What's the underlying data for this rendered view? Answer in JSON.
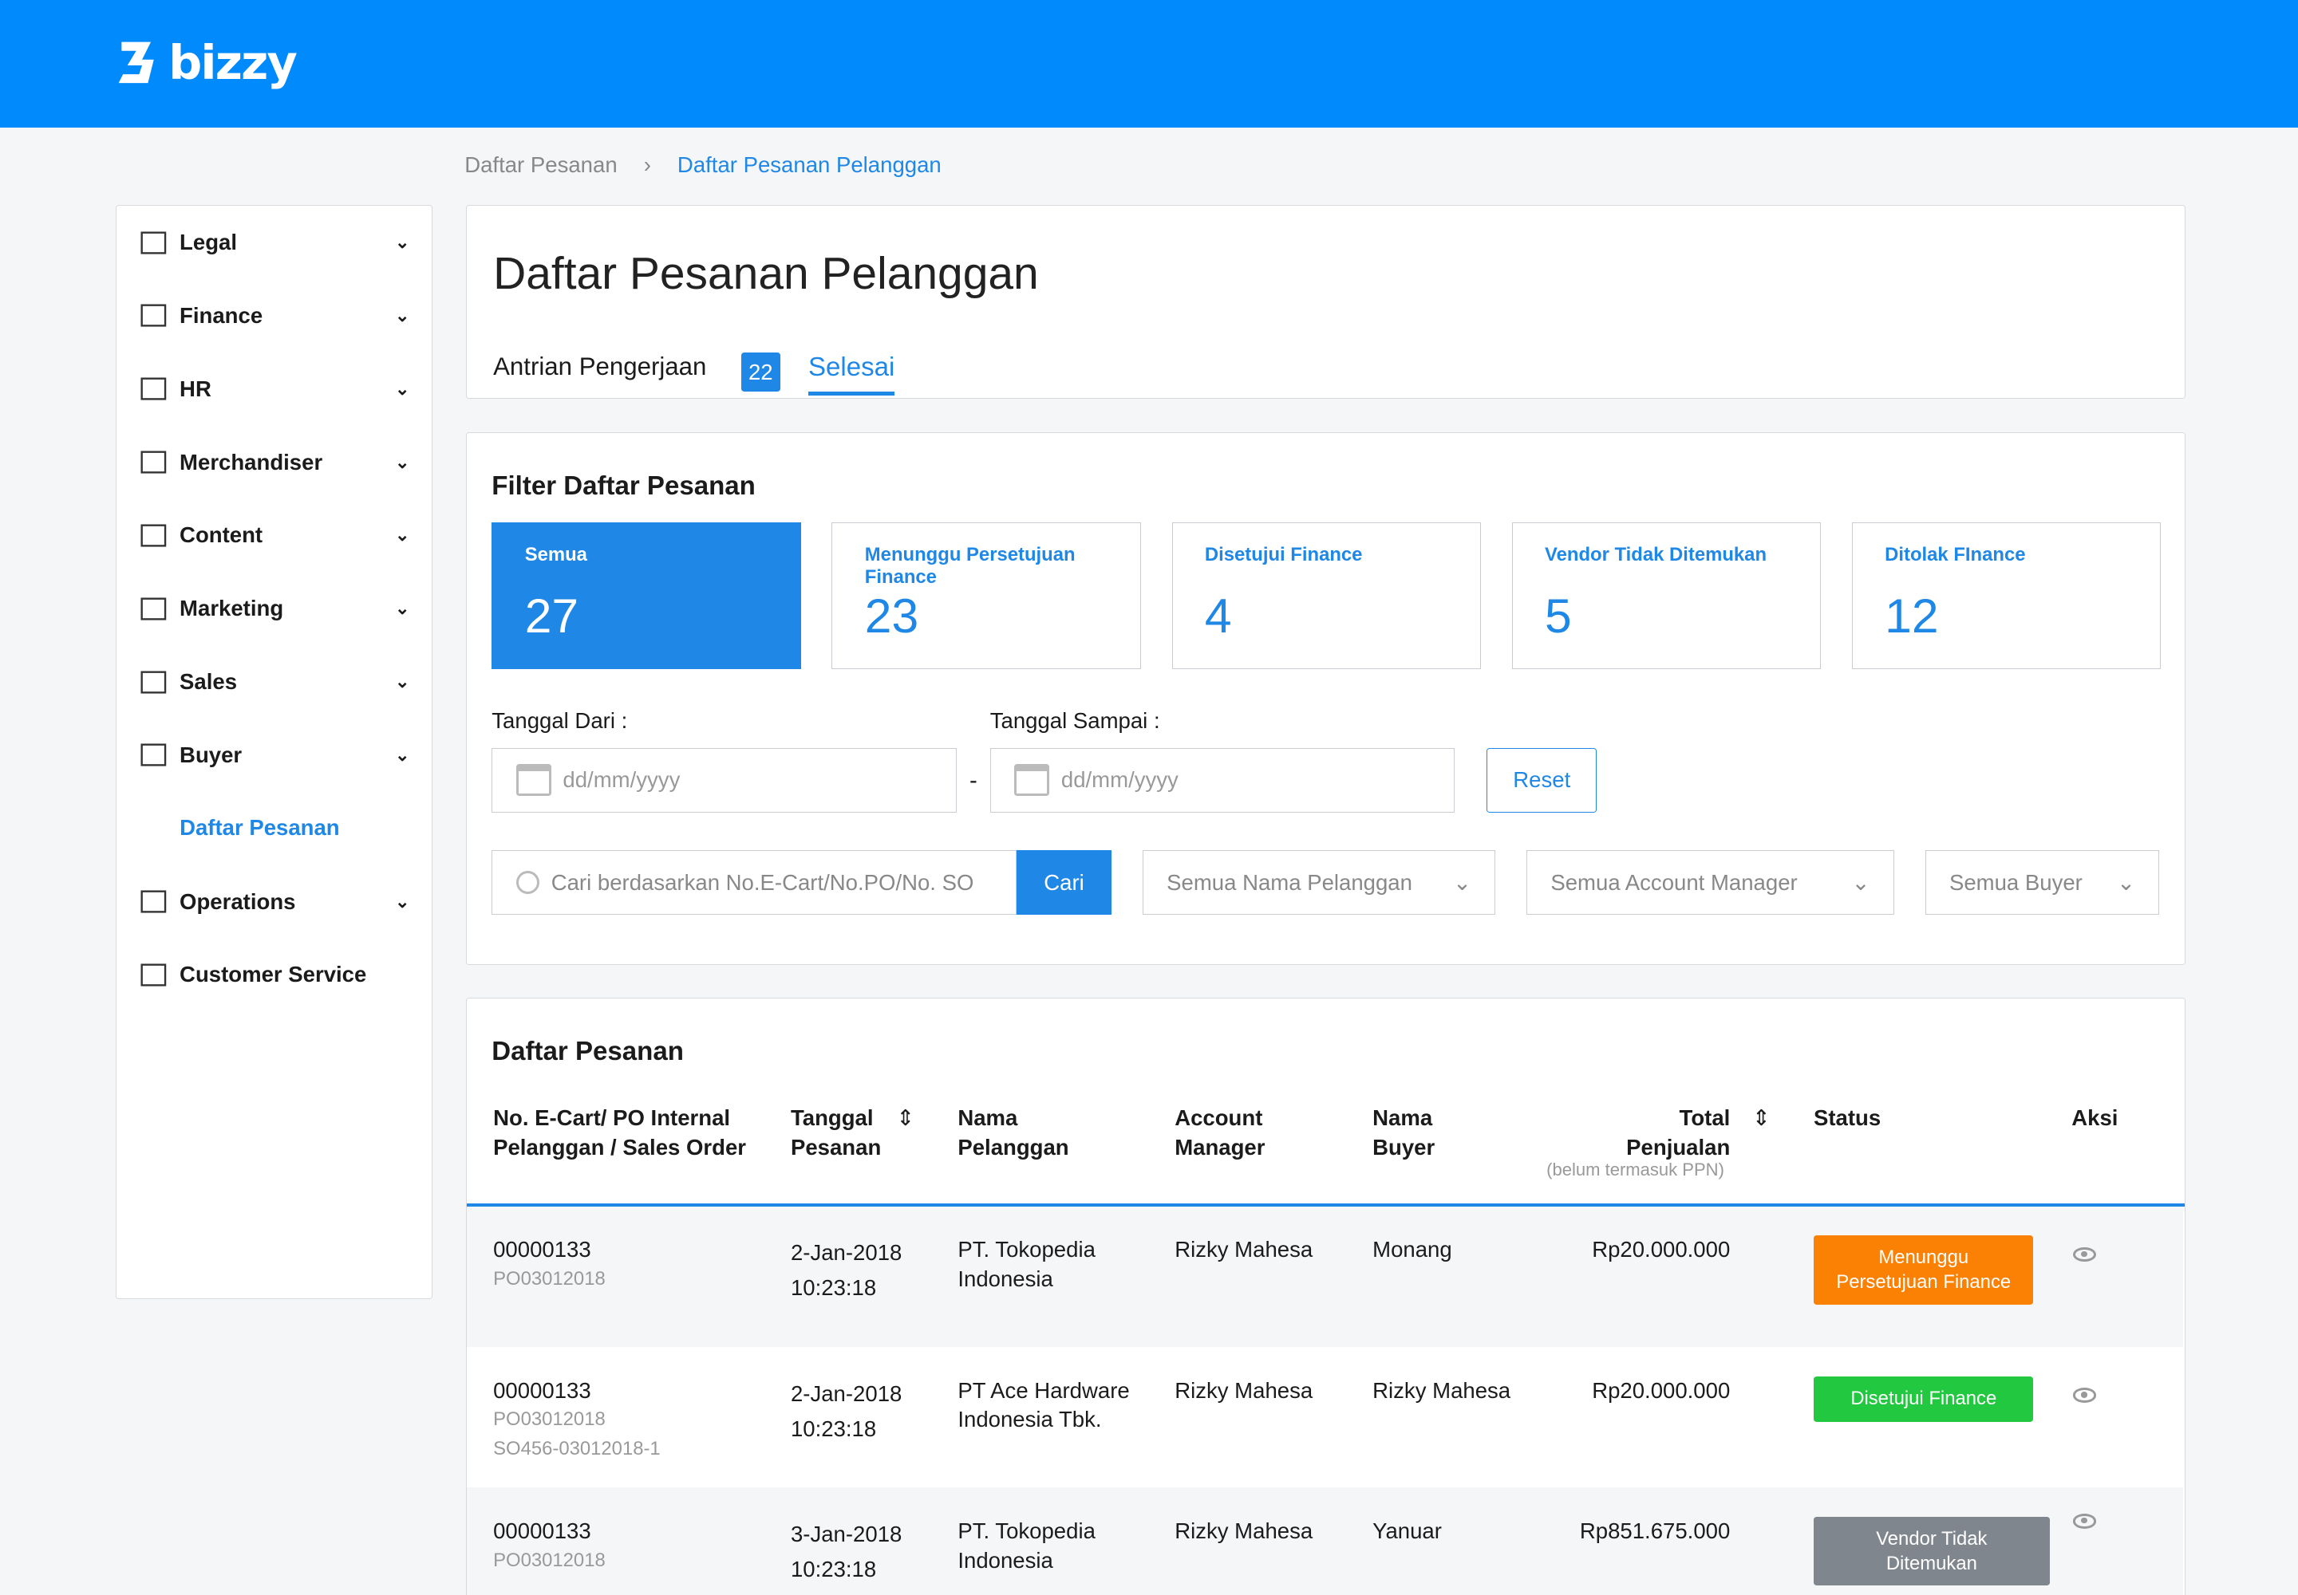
{
  "brand": {
    "name": "bizzy",
    "color": "#008afc"
  },
  "breadcrumb": [
    "Daftar Pesanan",
    "Daftar Pesanan Pelanggan"
  ],
  "sidebar": {
    "items": [
      {
        "label": "Legal",
        "icon": "handshake-icon"
      },
      {
        "label": "Finance",
        "icon": "money-icon"
      },
      {
        "label": "HR",
        "icon": "people-icon"
      },
      {
        "label": "Merchandiser",
        "icon": "clipboard-icon"
      },
      {
        "label": "Content",
        "icon": "newspaper-icon"
      },
      {
        "label": "Marketing",
        "icon": "chart-icon"
      },
      {
        "label": "Sales",
        "icon": "bar-chart-icon"
      },
      {
        "label": "Buyer",
        "icon": "badge-icon"
      },
      {
        "label": "Daftar Pesanan",
        "sub": true
      },
      {
        "label": "Operations",
        "icon": "document-icon"
      },
      {
        "label": "Customer Service",
        "icon": "headset-icon"
      }
    ]
  },
  "page": {
    "title": "Daftar Pesanan Pelanggan",
    "tabs": [
      {
        "label": "Antrian Pengerjaan",
        "count": "22"
      },
      {
        "label": "Selesai"
      }
    ]
  },
  "filter": {
    "title": "Filter Daftar Pesanan",
    "stats": [
      {
        "label": "Semua",
        "value": "27"
      },
      {
        "label": "Menunggu Persetujuan Finance",
        "value": "23"
      },
      {
        "label": "Disetujui Finance",
        "value": "4"
      },
      {
        "label": "Vendor Tidak Ditemukan",
        "value": "5"
      },
      {
        "label": "Ditolak FInance",
        "value": "12"
      }
    ],
    "date_from_label": "Tanggal Dari :",
    "date_to_label": "Tanggal Sampai :",
    "date_placeholder": "dd/mm/yyyy",
    "dash": "-",
    "reset": "Reset",
    "search_placeholder": "Cari berdasarkan No.E-Cart/No.PO/No. SO",
    "search_button": "Cari",
    "selects": [
      "Semua Nama Pelanggan",
      "Semua Account Manager",
      "Semua Buyer"
    ]
  },
  "table": {
    "title": "Daftar Pesanan",
    "headers": {
      "order": "No. E-Cart/ PO Internal Pelanggan / Sales Order",
      "date": "Tanggal Pesanan",
      "customer": "Nama Pelanggan",
      "am": "Account Manager",
      "buyer": "Nama Buyer",
      "total": "Total Penjualan",
      "total_note": "(belum termasuk PPN)",
      "status": "Status",
      "action": "Aksi"
    },
    "rows": [
      {
        "no": "00000133",
        "po": "PO03012018",
        "so": "",
        "date": "2-Jan-2018",
        "time": "10:23:18",
        "customer": "PT. Tokopedia Indonesia",
        "am": "Rizky Mahesa",
        "buyer": "Monang",
        "total": "Rp20.000.000",
        "status": "Menunggu Persetujuan Finance",
        "status_color": "#fb8104"
      },
      {
        "no": "00000133",
        "po": "PO03012018",
        "so": "SO456-03012018-1",
        "date": "2-Jan-2018",
        "time": "10:23:18",
        "customer": "PT Ace Hardware Indonesia Tbk.",
        "am": "Rizky Mahesa",
        "buyer": "Rizky Mahesa",
        "total": "Rp20.000.000",
        "status": "Disetujui Finance",
        "status_color": "#22c940"
      },
      {
        "no": "00000133",
        "po": "PO03012018",
        "so": "",
        "date": "3-Jan-2018",
        "time": "10:23:18",
        "customer": "PT. Tokopedia Indonesia",
        "am": "Rizky Mahesa",
        "buyer": "Yanuar",
        "total": "Rp851.675.000",
        "status": "Vendor Tidak Ditemukan",
        "status_color": "#80868d"
      }
    ]
  }
}
